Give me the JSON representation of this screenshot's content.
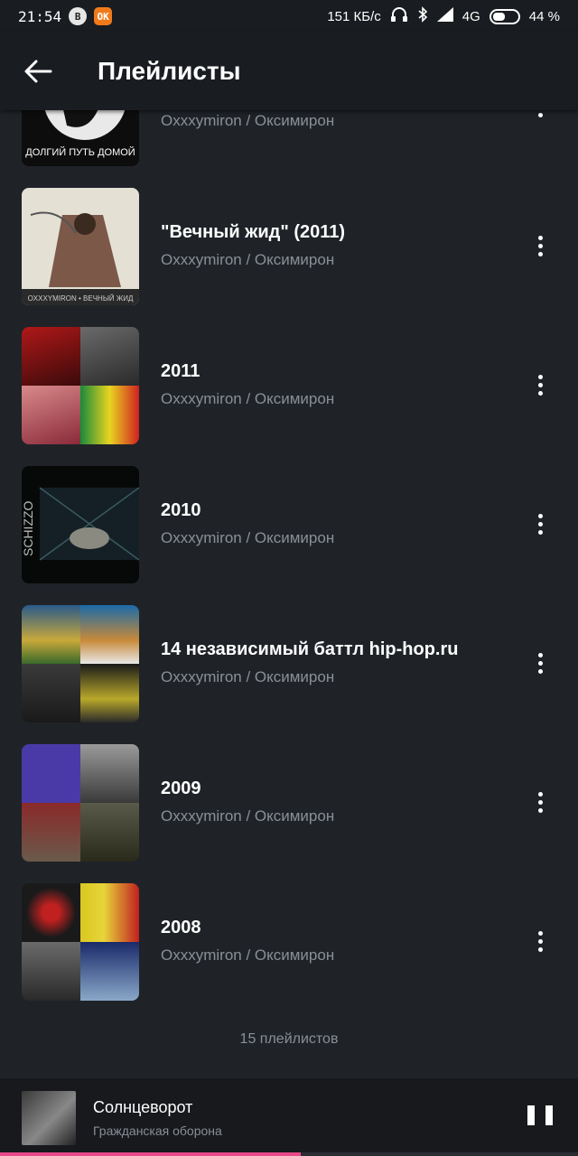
{
  "status_bar": {
    "time": "21:54",
    "app_icon_1": "В",
    "app_icon_2": "OK",
    "network_speed": "151 КБ/с",
    "network_type": "4G",
    "battery": "44 %",
    "icons": [
      "headphones-icon",
      "bluetooth-icon",
      "signal-icon",
      "battery-icon"
    ]
  },
  "header": {
    "title": "Плейлисты",
    "back_icon": "arrow-left-icon"
  },
  "playlists": [
    {
      "name": "",
      "artist": "Oxxxymiron / Оксимирон",
      "cover_caption": "ДОЛГИЙ ПУТЬ ДОМОЙ",
      "colors": [
        "#111111",
        "#e8e8e8",
        "#111111",
        "#e8e8e8"
      ]
    },
    {
      "name": "\"Вечный жид\" (2011)",
      "artist": "Oxxxymiron / Оксимирон",
      "cover_caption": "OXXXYMIRON • ВЕЧНЫЙ ЖИД",
      "colors": [
        "#d9d5c8",
        "#7a4a30",
        "#b9b4a6",
        "#5a4a3a"
      ]
    },
    {
      "name": "2011",
      "artist": "Oxxxymiron / Оксимирон",
      "colors": [
        "#9e1b1b",
        "#4a4a4a",
        "#c96a6a",
        "#d4c21a"
      ]
    },
    {
      "name": "2010",
      "artist": "Oxxxymiron / Оксимирон",
      "colors": [
        "#0a0a0a",
        "#1e2a2e",
        "#0f1416",
        "#2a3538"
      ]
    },
    {
      "name": "14 независимый баттл hip-hop.ru",
      "artist": "Oxxxymiron / Оксимирон",
      "colors": [
        "#3a6a8a",
        "#c87a2a",
        "#2a2a2a",
        "#8a7a2a"
      ]
    },
    {
      "name": "2009",
      "artist": "Oxxxymiron / Оксимирон",
      "colors": [
        "#4a3a9a",
        "#8a8a8a",
        "#6a4a3a",
        "#3a3a2a"
      ]
    },
    {
      "name": "2008",
      "artist": "Oxxxymiron / Оксимирон",
      "colors": [
        "#1a1a1a",
        "#c8b82a",
        "#5a5a5a",
        "#1a2a5a"
      ]
    }
  ],
  "footer": {
    "count_label": "15 плейлистов"
  },
  "now_playing": {
    "track": "Солнцеворот",
    "artist": "Гражданская оборона",
    "pause_icon": "pause-icon",
    "progress": 0.52,
    "progress_color": "#e64a8a"
  }
}
